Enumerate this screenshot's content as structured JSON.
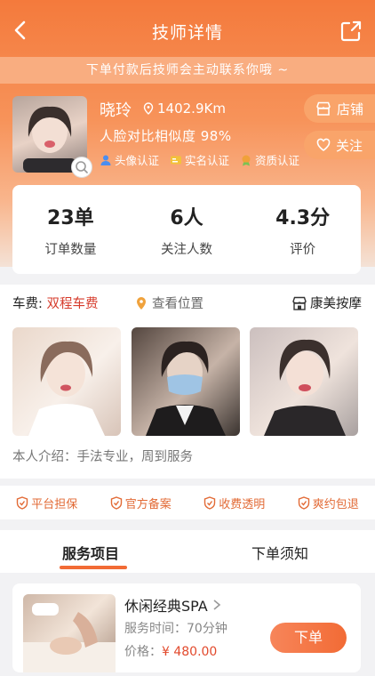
{
  "header": {
    "title": "技师详情"
  },
  "notice": "下单付款后技师会主动联系你哦 ~",
  "profile": {
    "name": "晓玲",
    "distance": "1402.9Km",
    "face_similarity": "人脸对比相似度 98%",
    "badges": [
      "头像认证",
      "实名认证",
      "资质认证"
    ]
  },
  "side_buttons": {
    "shop": "店铺",
    "follow": "关注"
  },
  "stats": [
    {
      "value": "23单",
      "label": "订单数量"
    },
    {
      "value": "6人",
      "label": "关注人数"
    },
    {
      "value": "4.3分",
      "label": "评价"
    }
  ],
  "fare": {
    "label": "车费:",
    "value": "双程车费"
  },
  "location_link": "查看位置",
  "shop_name": "康美按摩",
  "intro": "本人介绍：手法专业，周到服务",
  "guarantees": [
    "平台担保",
    "官方备案",
    "收费透明",
    "爽约包退"
  ],
  "tabs": [
    "服务项目",
    "下单须知"
  ],
  "service": {
    "name": "休闲经典SPA",
    "time": "服务时间：70分钟",
    "price_label": "价格：",
    "price": "¥ 480.00",
    "order_label": "下单"
  },
  "colors": {
    "brand": "#f26b35",
    "price": "#e24a2d",
    "fare": "#d63b2b"
  }
}
